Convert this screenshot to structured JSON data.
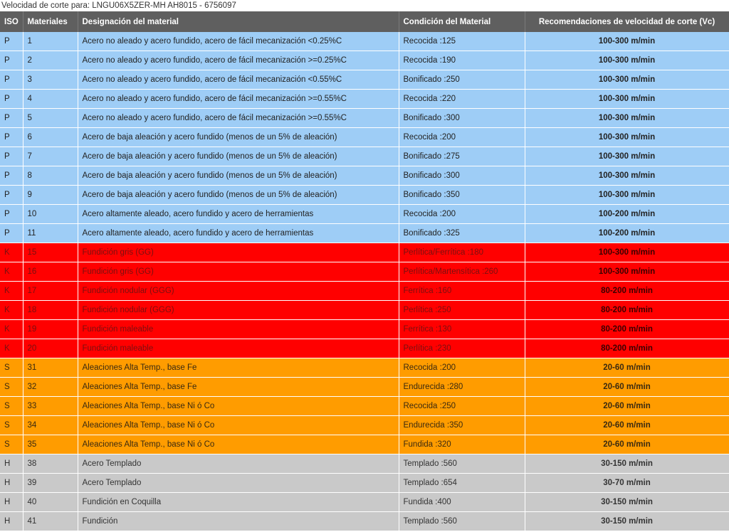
{
  "page_title": "Velocidad de corte para: LNGU06X5ZER-MH AH8015 - 6756097",
  "columns": {
    "iso": "ISO",
    "materials": "Materiales",
    "designation": "Designación del material",
    "condition": "Condición del Material",
    "vc": "Recomendaciones de velocidad de corte (Vc)"
  },
  "iso_colors": {
    "P": "#9ecdf6",
    "K": "#ff0000",
    "S": "#ff9c00",
    "H": "#c9c9c9"
  },
  "rows": [
    {
      "iso": "P",
      "num": "1",
      "designation": "Acero no aleado y acero fundido, acero de fácil mecanización <0.25%C",
      "condition": "Recocida :125",
      "vc": "100-300 m/min"
    },
    {
      "iso": "P",
      "num": "2",
      "designation": "Acero no aleado y acero fundido, acero de fácil mecanización >=0.25%C",
      "condition": "Recocida :190",
      "vc": "100-300 m/min"
    },
    {
      "iso": "P",
      "num": "3",
      "designation": "Acero no aleado y acero fundido, acero de fácil mecanización <0.55%C",
      "condition": "Bonificado :250",
      "vc": "100-300 m/min"
    },
    {
      "iso": "P",
      "num": "4",
      "designation": "Acero no aleado y acero fundido, acero de fácil mecanización >=0.55%C",
      "condition": "Recocida :220",
      "vc": "100-300 m/min"
    },
    {
      "iso": "P",
      "num": "5",
      "designation": "Acero no aleado y acero fundido, acero de fácil mecanización >=0.55%C",
      "condition": "Bonificado :300",
      "vc": "100-300 m/min"
    },
    {
      "iso": "P",
      "num": "6",
      "designation": "Acero de baja aleación y acero fundido (menos de un 5% de aleación)",
      "condition": "Recocida :200",
      "vc": "100-300 m/min"
    },
    {
      "iso": "P",
      "num": "7",
      "designation": "Acero de baja aleación y acero fundido (menos de un 5% de aleación)",
      "condition": "Bonificado :275",
      "vc": "100-300 m/min"
    },
    {
      "iso": "P",
      "num": "8",
      "designation": "Acero de baja aleación y acero fundido (menos de un 5% de aleación)",
      "condition": "Bonificado :300",
      "vc": "100-300 m/min"
    },
    {
      "iso": "P",
      "num": "9",
      "designation": "Acero de baja aleación y acero fundido (menos de un 5% de aleación)",
      "condition": "Bonificado :350",
      "vc": "100-300 m/min"
    },
    {
      "iso": "P",
      "num": "10",
      "designation": "Acero altamente aleado, acero fundido y acero de herramientas",
      "condition": "Recocida :200",
      "vc": "100-200 m/min"
    },
    {
      "iso": "P",
      "num": "11",
      "designation": "Acero altamente aleado, acero fundido y acero de herramientas",
      "condition": "Bonificado :325",
      "vc": "100-200 m/min"
    },
    {
      "iso": "K",
      "num": "15",
      "designation": "Fundición gris (GG)",
      "condition": "Perlítica/Ferrítica :180",
      "vc": "100-300 m/min"
    },
    {
      "iso": "K",
      "num": "16",
      "designation": "Fundición gris (GG)",
      "condition": "Perlítica/Martensítica :260",
      "vc": "100-300 m/min"
    },
    {
      "iso": "K",
      "num": "17",
      "designation": "Fundición nodular (GGG)",
      "condition": "Ferrítica :160",
      "vc": "80-200 m/min"
    },
    {
      "iso": "K",
      "num": "18",
      "designation": "Fundición nodular (GGG)",
      "condition": "Perlítica :250",
      "vc": "80-200 m/min"
    },
    {
      "iso": "K",
      "num": "19",
      "designation": "Fundición maleable",
      "condition": "Ferrítica :130",
      "vc": "80-200 m/min"
    },
    {
      "iso": "K",
      "num": "20",
      "designation": "Fundición maleable",
      "condition": "Perlítica :230",
      "vc": "80-200 m/min"
    },
    {
      "iso": "S",
      "num": "31",
      "designation": "Aleaciones Alta Temp., base Fe",
      "condition": "Recocida :200",
      "vc": "20-60 m/min"
    },
    {
      "iso": "S",
      "num": "32",
      "designation": "Aleaciones Alta Temp., base Fe",
      "condition": "Endurecida :280",
      "vc": "20-60 m/min"
    },
    {
      "iso": "S",
      "num": "33",
      "designation": "Aleaciones Alta Temp., base Ni ó Co",
      "condition": "Recocida :250",
      "vc": "20-60 m/min"
    },
    {
      "iso": "S",
      "num": "34",
      "designation": "Aleaciones Alta Temp., base Ni ó Co",
      "condition": "Endurecida :350",
      "vc": "20-60 m/min"
    },
    {
      "iso": "S",
      "num": "35",
      "designation": "Aleaciones Alta Temp., base Ni ó Co",
      "condition": "Fundida :320",
      "vc": "20-60 m/min"
    },
    {
      "iso": "H",
      "num": "38",
      "designation": "Acero Templado",
      "condition": "Templado :560",
      "vc": "30-150 m/min"
    },
    {
      "iso": "H",
      "num": "39",
      "designation": "Acero Templado",
      "condition": "Templado :654",
      "vc": "30-70 m/min"
    },
    {
      "iso": "H",
      "num": "40",
      "designation": "Fundición en Coquilla",
      "condition": "Fundida :400",
      "vc": "30-150 m/min"
    },
    {
      "iso": "H",
      "num": "41",
      "designation": "Fundición",
      "condition": "Templado :560",
      "vc": "30-150 m/min"
    }
  ]
}
